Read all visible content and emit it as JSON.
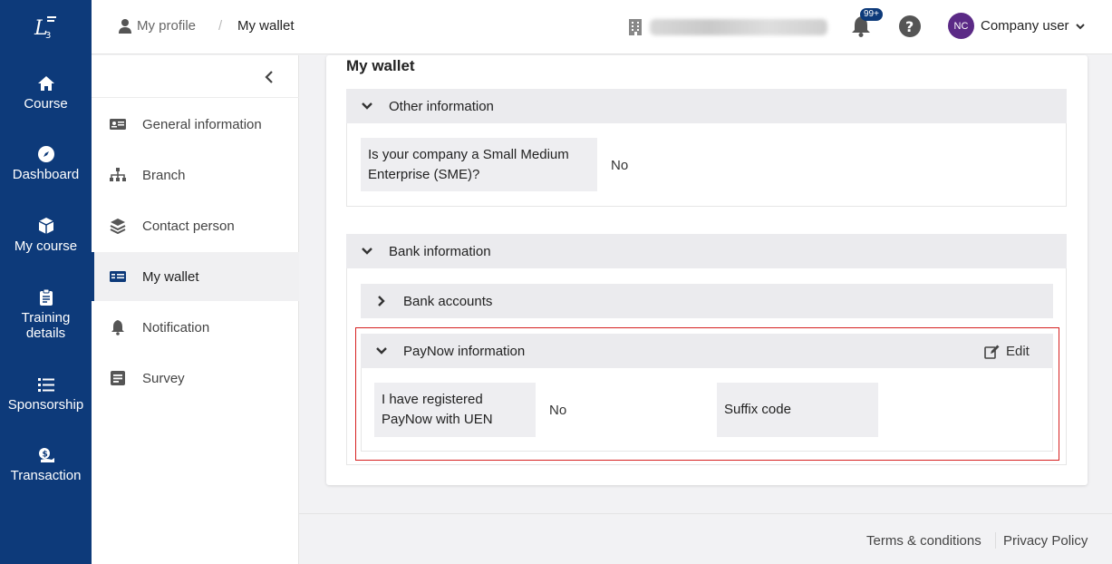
{
  "nav": {
    "items": [
      {
        "label": "Course",
        "icon": "home-icon"
      },
      {
        "label": "Dashboard",
        "icon": "compass-icon"
      },
      {
        "label": "My course",
        "icon": "box-icon"
      },
      {
        "label": "Training details",
        "icon": "clipboard-icon"
      },
      {
        "label": "Sponsorship",
        "icon": "list-icon"
      },
      {
        "label": "Transaction",
        "icon": "money-icon"
      }
    ]
  },
  "header": {
    "breadcrumb": [
      "My profile",
      "My wallet"
    ],
    "breadcrumb_sep": "/",
    "notifications_badge": "99+",
    "user_initials": "NC",
    "user_role": "Company user"
  },
  "profile_menu": {
    "items": [
      {
        "label": "General information"
      },
      {
        "label": "Branch"
      },
      {
        "label": "Contact person"
      },
      {
        "label": "My wallet"
      },
      {
        "label": "Notification"
      },
      {
        "label": "Survey"
      }
    ],
    "active": "My wallet"
  },
  "main": {
    "title": "My wallet",
    "other_info": {
      "heading": "Other information",
      "sme_label": "Is your company a Small Medium Enterprise (SME)?",
      "sme_value": "No"
    },
    "bank_info": {
      "heading": "Bank information",
      "bank_accounts_heading": "Bank accounts",
      "paynow": {
        "heading": "PayNow information",
        "edit_label": "Edit",
        "uen_label": "I have registered PayNow with UEN",
        "uen_value": "No",
        "suffix_label": "Suffix code",
        "suffix_value": ""
      }
    }
  },
  "footer": {
    "terms": "Terms & conditions",
    "privacy": "Privacy Policy"
  },
  "colors": {
    "nav_bg": "#0d3a7a",
    "avatar_bg": "#5b2a86",
    "highlight_border": "#d62020"
  }
}
